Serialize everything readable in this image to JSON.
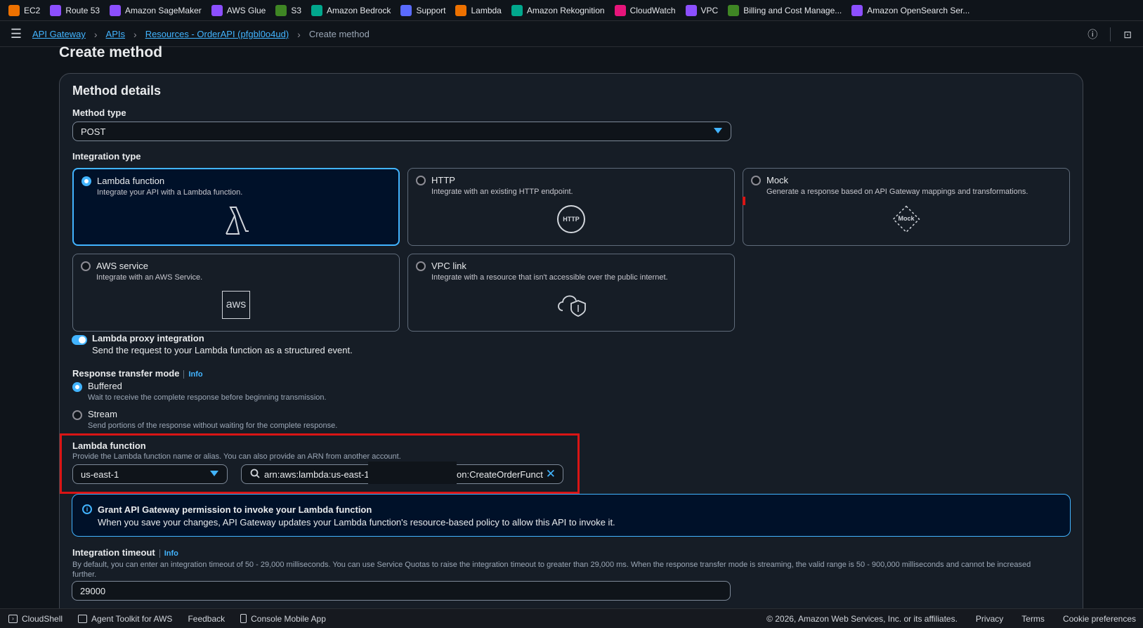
{
  "favorites": [
    {
      "label": "EC2",
      "icon": "ec2-icon",
      "color": "#ed7100"
    },
    {
      "label": "Route 53",
      "icon": "route53-icon",
      "color": "#8c4fff"
    },
    {
      "label": "Amazon SageMaker",
      "icon": "sagemaker-icon",
      "color": "#8c4fff"
    },
    {
      "label": "AWS Glue",
      "icon": "glue-icon",
      "color": "#8c4fff"
    },
    {
      "label": "S3",
      "icon": "s3-icon",
      "color": "#3f8624"
    },
    {
      "label": "Amazon Bedrock",
      "icon": "bedrock-icon",
      "color": "#01a88d"
    },
    {
      "label": "Support",
      "icon": "support-icon",
      "color": "#5a6bff"
    },
    {
      "label": "Lambda",
      "icon": "lambda-icon",
      "color": "#ed7100"
    },
    {
      "label": "Amazon Rekognition",
      "icon": "rekognition-icon",
      "color": "#01a88d"
    },
    {
      "label": "CloudWatch",
      "icon": "cloudwatch-icon",
      "color": "#e7157b"
    },
    {
      "label": "VPC",
      "icon": "vpc-icon",
      "color": "#8c4fff"
    },
    {
      "label": "Billing and Cost Manage...",
      "icon": "billing-icon",
      "color": "#3f8624"
    },
    {
      "label": "Amazon OpenSearch Ser...",
      "icon": "opensearch-icon",
      "color": "#8c4fff"
    }
  ],
  "breadcrumb": {
    "items": [
      "API Gateway",
      "APIs",
      "Resources - OrderAPI (pfgbl0o4ud)"
    ],
    "current": "Create method"
  },
  "page": {
    "title": "Create method"
  },
  "method_details": {
    "heading": "Method details",
    "method_type_label": "Method type",
    "method_type_value": "POST",
    "integration_type_label": "Integration type",
    "integration_types": [
      {
        "title": "Lambda function",
        "desc": "Integrate your API with a Lambda function.",
        "selected": true,
        "icon": "lambda-icon"
      },
      {
        "title": "HTTP",
        "desc": "Integrate with an existing HTTP endpoint.",
        "selected": false,
        "icon": "http-icon",
        "icon_text": "HTTP"
      },
      {
        "title": "Mock",
        "desc": "Generate a response based on API Gateway mappings and transformations.",
        "selected": false,
        "icon": "mock-icon",
        "icon_text": "Mock"
      },
      {
        "title": "AWS service",
        "desc": "Integrate with an AWS Service.",
        "selected": false,
        "icon": "aws-icon",
        "icon_text": "aws"
      },
      {
        "title": "VPC link",
        "desc": "Integrate with a resource that isn't accessible over the public internet.",
        "selected": false,
        "icon": "vpc-link-icon"
      }
    ],
    "proxy": {
      "title": "Lambda proxy integration",
      "desc": "Send the request to your Lambda function as a structured event.",
      "enabled": true
    },
    "transfer_mode": {
      "label": "Response transfer mode",
      "info": "Info",
      "options": [
        {
          "title": "Buffered",
          "desc": "Wait to receive the complete response before beginning transmission.",
          "selected": true
        },
        {
          "title": "Stream",
          "desc": "Send portions of the response without waiting for the complete response.",
          "selected": false
        }
      ]
    },
    "lambda_function": {
      "label": "Lambda function",
      "desc": "Provide the Lambda function name or alias. You can also provide an ARN from another account.",
      "region": "us-east-1",
      "arn_prefix": "arn:aws:lambda:us-east-1:",
      "arn_suffix": "on:CreateOrderFunct"
    },
    "alert": {
      "title": "Grant API Gateway permission to invoke your Lambda function",
      "desc": "When you save your changes, API Gateway updates your Lambda function's resource-based policy to allow this API to invoke it.",
      "icon_text": "i"
    },
    "timeout": {
      "label": "Integration timeout",
      "info": "Info",
      "desc": "By default, you can enter an integration timeout of 50 - 29,000 milliseconds. You can use Service Quotas to raise the integration timeout to greater than 29,000 ms. When the response transfer mode is streaming, the valid range is 50 - 900,000 milliseconds and cannot be increased further.",
      "value": "29000"
    }
  },
  "footer": {
    "left": [
      "CloudShell",
      "Agent Toolkit for AWS",
      "Feedback",
      "Console Mobile App"
    ],
    "copyright": "© 2026, Amazon Web Services, Inc. or its affiliates.",
    "right": [
      "Privacy",
      "Terms",
      "Cookie preferences"
    ]
  },
  "colors": {
    "accent": "#42b4ff",
    "highlight": "#d91515",
    "background": "#0f141a"
  }
}
